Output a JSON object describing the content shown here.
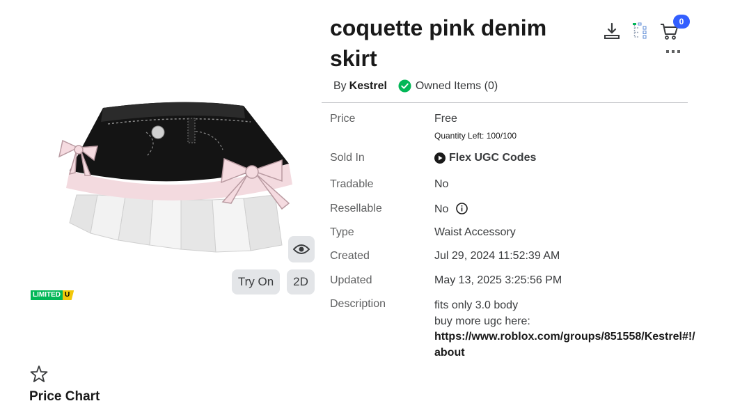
{
  "item": {
    "title": "coquette pink denim skirt",
    "by_label": "By",
    "creator": "Kestrel",
    "owned_label": "Owned Items (0)",
    "cart_count": "0"
  },
  "preview": {
    "try_on_label": "Try On",
    "twod_label": "2D",
    "limited_badge": "LIMITED",
    "limited_badge_u": "U"
  },
  "price_chart_label": "Price Chart",
  "details": {
    "price_label": "Price",
    "price_value": "Free",
    "quantity_left": "Quantity Left: 100/100",
    "sold_in_label": "Sold In",
    "sold_in_value": "Flex UGC Codes",
    "tradable_label": "Tradable",
    "tradable_value": "No",
    "resellable_label": "Resellable",
    "resellable_value": "No",
    "type_label": "Type",
    "type_value": "Waist Accessory",
    "created_label": "Created",
    "created_value": "Jul 29, 2024 11:52:39 AM",
    "updated_label": "Updated",
    "updated_value": "May 13, 2025 3:25:56 PM",
    "description_label": "Description",
    "description_line1": "fits only 3.0 body",
    "description_line2": "buy more ugc here:",
    "description_link1": "https://www.roblox.com/groups/851558/Kestrel#!/",
    "description_link2": "about"
  },
  "icons": {
    "download": "download-icon",
    "tree": "hierarchy-icon",
    "cart": "cart-icon",
    "more": "more-icon",
    "eye": "eye-icon",
    "star": "star-icon",
    "check": "check-circle-icon",
    "play": "play-circle-icon",
    "info": "info-icon"
  },
  "colors": {
    "owned_check": "#02b757",
    "cart_badge": "#335fff",
    "limited_green": "#02b757",
    "limited_yellow": "#f2c80a",
    "button_bg": "#e3e5e8"
  }
}
